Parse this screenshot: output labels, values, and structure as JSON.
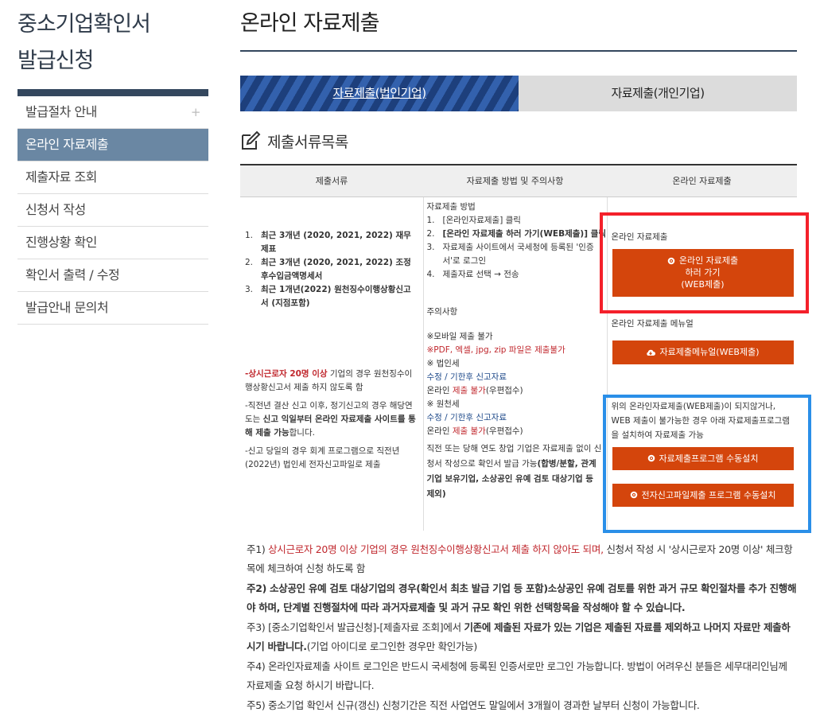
{
  "sidebar": {
    "title_line1": "중소기업확인서",
    "title_line2": "발급신청",
    "items": [
      {
        "label": "발급절차 안내",
        "expand": "+"
      },
      {
        "label": "온라인 자료제출"
      },
      {
        "label": "제출자료 조회"
      },
      {
        "label": "신청서 작성"
      },
      {
        "label": "진행상황 확인"
      },
      {
        "label": "확인서 출력 / 수정"
      },
      {
        "label": "발급안내 문의처"
      }
    ]
  },
  "main": {
    "title": "온라인 자료제출",
    "tabs": [
      "자료제출(법인기업)",
      "자료제출(개인기업)"
    ],
    "section_title": "제출서류목록",
    "table": {
      "headers": [
        "제출서류",
        "자료제출 방법 및 주의사항",
        "온라인 자료제출"
      ],
      "docs": [
        {
          "num": "1.",
          "text": "최근 3개년 (2020, 2021, 2022) 재무제표"
        },
        {
          "num": "2.",
          "text": "최근 3개년 (2020, 2021, 2022) 조정후수입금액명세서"
        },
        {
          "num": "3.",
          "text": "최근 1개년(2022) 원천징수이행상황신고서 (지점포함)"
        }
      ],
      "doc_note1_red": "-상시근로자 20명 이상",
      "doc_note1_rest": " 기업의 경우 원천징수이행상황신고서 제출 하지 않도록 함",
      "doc_note2_a": "-직전년 결산 신고 이후, 정기신고의 경우 해당연도는 ",
      "doc_note2_b": "신고 익일부터 온라인 자료제출 사이트를 통해 제출 가능",
      "doc_note2_c": "합니다.",
      "doc_note3": "-신고 당일의 경우 회계 프로그램으로 직전년(2022년) 법인세 전자신고파일로 제출",
      "method_title": "자료제출 방법",
      "steps": [
        {
          "num": "1.",
          "text": "[온라인자료제출] 클릭"
        },
        {
          "num": "2.",
          "text": "[온라인 자료제출 하러 가기(WEB제출)] 클릭"
        },
        {
          "num": "3.",
          "text": "자료제출 사이트에서 국세청에 등록된 '인증서'로 로그인"
        },
        {
          "num": "4.",
          "text": "제출자료 선택 → 전송"
        }
      ],
      "caution_title": "주의사항",
      "caution_mobile": "※모바일 제출 불가",
      "caution_formats": "※PDF, 엑셀, jpg, zip 파일은 제출불가",
      "caution_corp": "※ 법인세",
      "corp_late": "수정 / 기한후 신고자료",
      "corp_online_a": "온라인 ",
      "corp_online_b": "제출 불가",
      "corp_online_c": "(우편접수)",
      "caution_wh": "※ 원천세",
      "wh_late": "수정 / 기한후 신고자료",
      "wh_online_a": "온라인 ",
      "wh_online_b": "제출 불가",
      "wh_online_c": "(우편접수)",
      "caution_final_a": "직전 또는 당해 연도 창업 기업은 자료제출 없이 신청서 작성으로 확인서 발급 가능",
      "caution_final_b": "(합병/분할, 관계기업 보유기업, 소상공인 유예 검토 대상기업 등 제외)",
      "online_label": "온라인 자료제출",
      "btn_web": [
        "온라인 자료제출",
        "하러 가기",
        "(WEB제출)"
      ],
      "manual_label": "온라인 자료제출 메뉴얼",
      "btn_manual": "자료제출메뉴얼(WEB제출)",
      "fallback_text": "위의 온라인자료제출(WEB제출)이 되지않거나, WEB 제출이 불가능한 경우 아래 자료제출프로그램을 설치하여 자료제출 가능",
      "btn_program": "자료제출프로그램 수동설치",
      "btn_efile": "전자신고파일제출 프로그램 수동설치"
    },
    "notes": {
      "n1_a": "주1) ",
      "n1_red": "상시근로자 20명 이상 기업의 경우 원천징수이행상황신고서 제출 하지 않아도 되며,",
      "n1_b": " 신청서 작성 시 '상시근로자 20명 이상' 체크항목에 체크하여 신청 하도록 함",
      "n2": "주2) 소상공인 유예 검토 대상기업의 경우(확인서 최초 발급 기업 등 포함)소상공인 유예 검토를 위한 과거 규모 확인절차를 추가 진행해야 하며, 단계별 진행절차에 따라 과거자료제출 및 과거 규모 확인 위한 선택항목을 작성해야 할 수 있습니다.",
      "n3_a": "주3) [중소기업확인서 발급신청]-[제출자료 조회]에서 ",
      "n3_b": "기존에 제출된 자료가 있는 기업은 제출된 자료를 제외하고 나머지 자료만 제출하시기 바랍니다.",
      "n3_c": "(기업 아이디로 로그인한 경우만 확인가능)",
      "n4": "주4) 온라인자료제출 사이트 로그인은 반드시 국세청에 등록된 인증서로만 로그인 가능합니다. 방법이 어려우신 분들은 세무대리인님께 자료제출 요청 하시기 바랍니다.",
      "n5": "주5) 중소기업 확인서 신규(갱신) 신청기간은 직전 사업연도 말일에서 3개월이 경과한 날부터 신청이 가능합니다."
    }
  },
  "colors": {
    "accent": "#d4450c",
    "nav_active": "#6a87a3",
    "highlight_red": "#f4202a",
    "highlight_blue": "#2a8fe8"
  }
}
